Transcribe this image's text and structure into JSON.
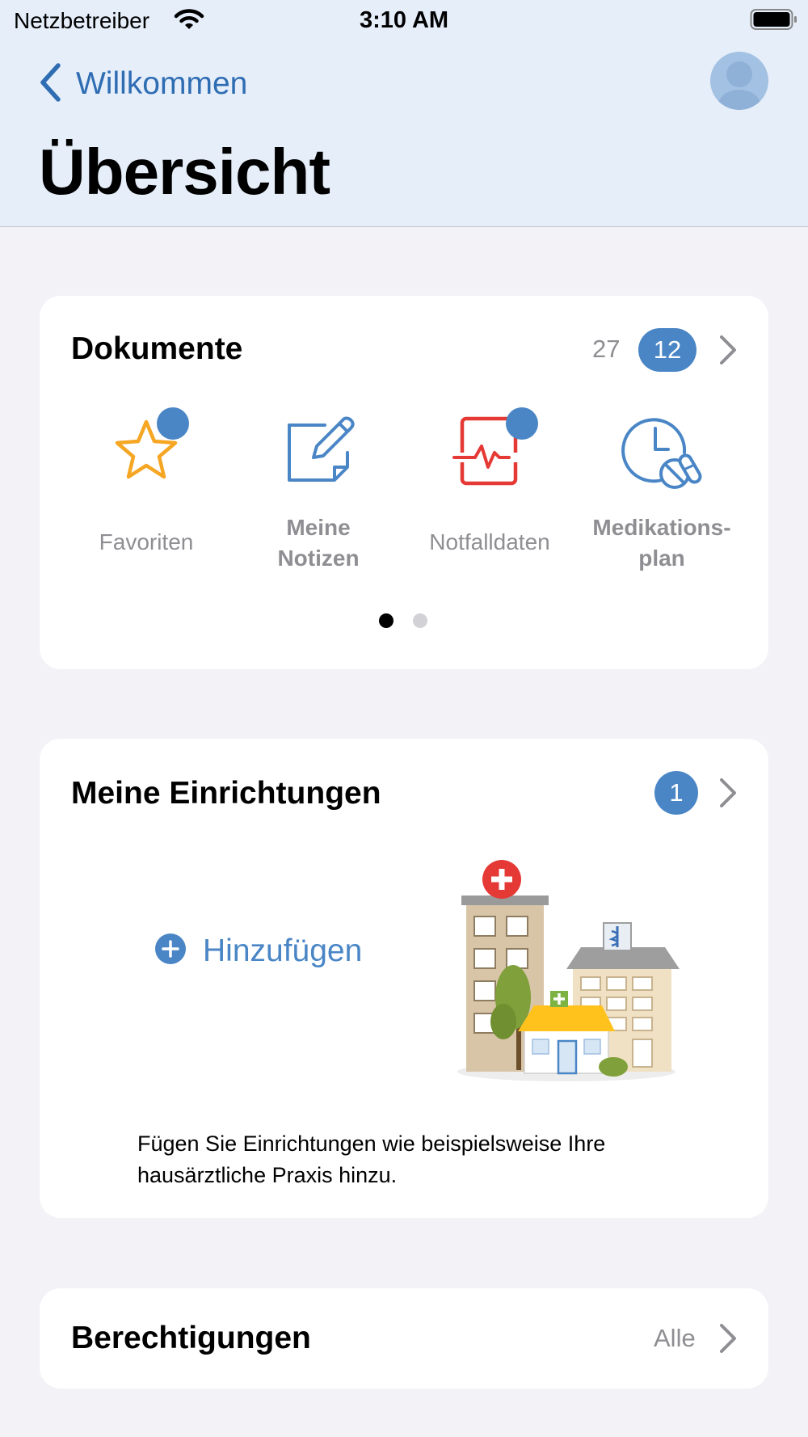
{
  "status_bar": {
    "carrier": "Netzbetreiber",
    "time": "3:10 AM",
    "wifi_icon": "wifi-icon",
    "battery_icon": "battery-icon"
  },
  "nav": {
    "back_label": "Willkommen",
    "back_icon": "chevron-left-icon",
    "avatar_icon": "person-avatar-icon",
    "title": "Übersicht"
  },
  "dokumente": {
    "title": "Dokumente",
    "count": "27",
    "badge": "12",
    "tiles": [
      {
        "label": "Favoriten",
        "icon": "star-icon",
        "badge_dot": true
      },
      {
        "label": "Meine Notizen",
        "line1": "Meine",
        "line2": "Notizen",
        "icon": "note-edit-icon",
        "badge_dot": false
      },
      {
        "label": "Notfalldaten",
        "icon": "emergency-data-icon",
        "badge_dot": true
      },
      {
        "label": "Medikationsplan",
        "line1": "Medikations-",
        "line2": "plan",
        "icon": "medication-plan-icon",
        "badge_dot": false
      }
    ],
    "page_indicator": {
      "pages": 2,
      "current": 1
    }
  },
  "einrichtungen": {
    "title": "Meine Einrichtungen",
    "badge": "1",
    "add_label": "Hinzufügen",
    "illustration": "healthcare-facilities-illustration",
    "description": "Fügen Sie Einrichtungen wie beispielsweise Ihre hausärztliche Praxis hinzu."
  },
  "berechtigungen": {
    "title": "Berechtigungen",
    "filter_label": "Alle"
  },
  "colors": {
    "accent": "#4a86c6",
    "header_bg": "#e6eefa",
    "star": "#f5a623",
    "emergency": "#e53935",
    "note": "#4a86c6"
  }
}
